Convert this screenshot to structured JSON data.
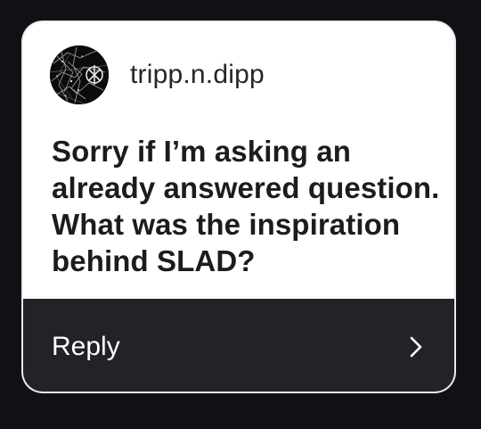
{
  "question_card": {
    "username": "tripp.n.dipp",
    "question": "Sorry if I’m asking an already answered question. What was the inspiration behind SLAD?",
    "reply_label": "Reply",
    "icons": {
      "avatar": "profile-picture",
      "chevron": "chevron-right-icon"
    }
  },
  "colors": {
    "background": "#0f1115",
    "card": "#ffffff",
    "reply_bar": "#222326",
    "text_dark": "#1c1c1c",
    "text_light": "#ffffff"
  }
}
